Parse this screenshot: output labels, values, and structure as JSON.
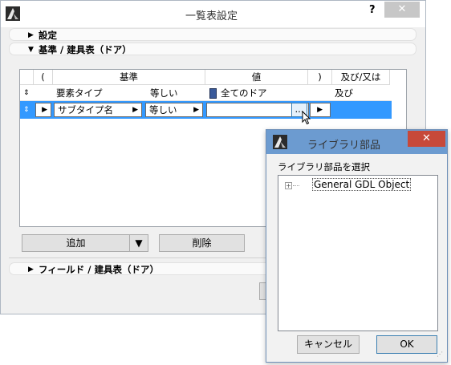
{
  "main_window": {
    "title": "一覧表設定",
    "help": "?",
    "close": "✕"
  },
  "sections": {
    "settings": "設定",
    "criteria": "基準 / 建具表（ドア）",
    "fields": "フィールド / 建具表（ドア）"
  },
  "criteria_table": {
    "headers": {
      "open_paren": "(",
      "criteria": "基準",
      "value": "値",
      "close_paren": ")",
      "and_or": "及び/又は"
    },
    "row1": {
      "criteria": "要素タイプ",
      "operator": "等しい",
      "value": "全てのドア",
      "and_or": "及び"
    },
    "row2": {
      "criteria": "サブタイプ名",
      "operator": "等しい",
      "browse": "..."
    }
  },
  "buttons": {
    "add": "追加",
    "delete": "削除"
  },
  "library_dialog": {
    "title": "ライブラリ部品",
    "close": "✕",
    "prompt": "ライブラリ部品を選択",
    "tree": {
      "expand": "+",
      "item": "General GDL Object"
    },
    "cancel": "キャンセル",
    "ok": "OK"
  },
  "colors": {
    "selection": "#3399ff",
    "dialog_titlebar": "#6c9bd0",
    "close_red": "#c7493a"
  },
  "icons": [
    "archicad-logo-icon",
    "door-icon",
    "mouse-cursor-icon",
    "dropdown-arrow-icon",
    "resize-grip-icon"
  ]
}
